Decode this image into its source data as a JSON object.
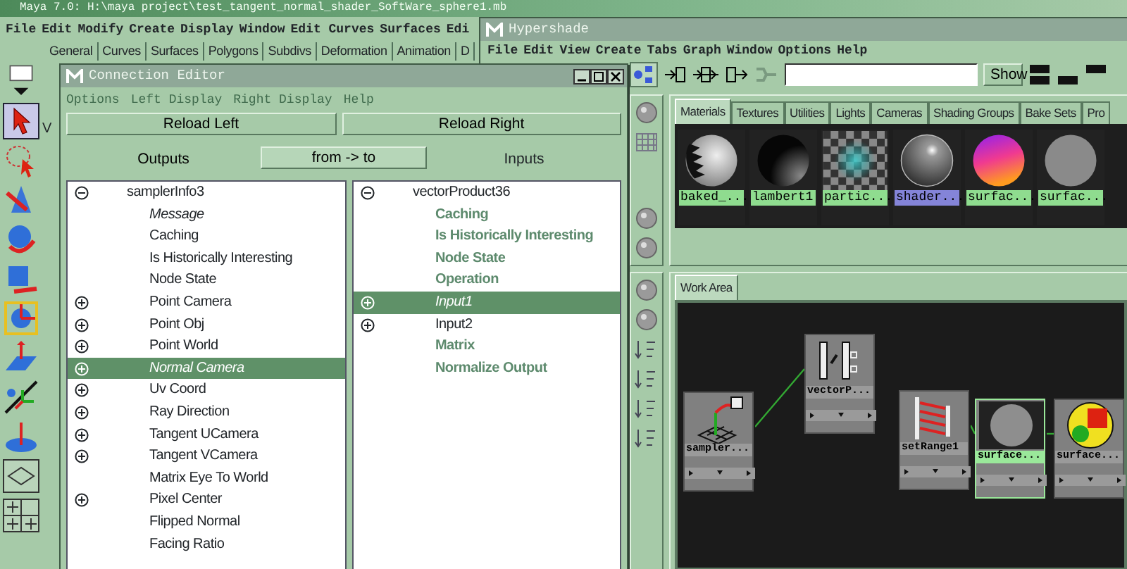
{
  "maya_window": {
    "title": "Maya 7.0: H:\\maya project\\test_tangent_normal_shader_SoftWare_sphere1.mb",
    "menu": [
      "File",
      "Edit",
      "Modify",
      "Create",
      "Display",
      "Window",
      "Edit Curves",
      "Surfaces",
      "Edi"
    ],
    "shelf_tabs": [
      "General",
      "Curves",
      "Surfaces",
      "Polygons",
      "Subdivs",
      "Deformation",
      "Animation",
      "D"
    ],
    "panel_menu": "V"
  },
  "connection_editor": {
    "title": "Connection Editor",
    "menu": [
      {
        "label": "Options",
        "disabled": true
      },
      {
        "label": "Left Display",
        "disabled": true
      },
      {
        "label": "Right Display",
        "disabled": true
      },
      {
        "label": "Help",
        "disabled": true
      }
    ],
    "reload_buttons": [
      "Reload Left",
      "Reload Right"
    ],
    "outputs_label": "Outputs",
    "mode_button": "from -> to",
    "inputs_label": "Inputs",
    "left_list": {
      "node": {
        "label": "samplerInfo3",
        "expanded": true
      },
      "attributes": [
        {
          "label": "Message",
          "expandable": false,
          "connected": true,
          "readonly": false,
          "selected": false
        },
        {
          "label": "Caching",
          "expandable": false,
          "connected": false,
          "readonly": false,
          "selected": false
        },
        {
          "label": "Is Historically Interesting",
          "expandable": false,
          "connected": false,
          "readonly": false,
          "selected": false
        },
        {
          "label": "Node State",
          "expandable": false,
          "connected": false,
          "readonly": false,
          "selected": false
        },
        {
          "label": "Point Camera",
          "expandable": true,
          "connected": false,
          "readonly": false,
          "selected": false
        },
        {
          "label": "Point Obj",
          "expandable": true,
          "connected": false,
          "readonly": false,
          "selected": false
        },
        {
          "label": "Point World",
          "expandable": true,
          "connected": false,
          "readonly": false,
          "selected": false
        },
        {
          "label": "Normal Camera",
          "expandable": true,
          "connected": true,
          "readonly": false,
          "selected": true
        },
        {
          "label": "Uv Coord",
          "expandable": true,
          "connected": false,
          "readonly": false,
          "selected": false
        },
        {
          "label": "Ray Direction",
          "expandable": true,
          "connected": false,
          "readonly": false,
          "selected": false
        },
        {
          "label": "Tangent UCamera",
          "expandable": true,
          "connected": false,
          "readonly": false,
          "selected": false
        },
        {
          "label": "Tangent VCamera",
          "expandable": true,
          "connected": false,
          "readonly": false,
          "selected": false
        },
        {
          "label": "Matrix Eye To World",
          "expandable": false,
          "connected": false,
          "readonly": false,
          "selected": false
        },
        {
          "label": "Pixel Center",
          "expandable": true,
          "connected": false,
          "readonly": false,
          "selected": false
        },
        {
          "label": "Flipped Normal",
          "expandable": false,
          "connected": false,
          "readonly": false,
          "selected": false
        },
        {
          "label": "Facing Ratio",
          "expandable": false,
          "connected": false,
          "readonly": false,
          "selected": false
        }
      ]
    },
    "right_list": {
      "node": {
        "label": "vectorProduct36",
        "expanded": true
      },
      "attributes": [
        {
          "label": "Caching",
          "expandable": false,
          "connected": false,
          "readonly": true,
          "selected": false
        },
        {
          "label": "Is Historically Interesting",
          "expandable": false,
          "connected": false,
          "readonly": true,
          "selected": false
        },
        {
          "label": "Node State",
          "expandable": false,
          "connected": false,
          "readonly": true,
          "selected": false
        },
        {
          "label": "Operation",
          "expandable": false,
          "connected": false,
          "readonly": true,
          "selected": false
        },
        {
          "label": "Input1",
          "expandable": true,
          "connected": true,
          "readonly": false,
          "selected": true
        },
        {
          "label": "Input2",
          "expandable": true,
          "connected": false,
          "readonly": false,
          "selected": false
        },
        {
          "label": "Matrix",
          "expandable": false,
          "connected": false,
          "readonly": true,
          "selected": false
        },
        {
          "label": "Normalize Output",
          "expandable": false,
          "connected": false,
          "readonly": true,
          "selected": false
        }
      ]
    }
  },
  "hypershade": {
    "title": "Hypershade",
    "menu": [
      "File",
      "Edit",
      "View",
      "Create",
      "Tabs",
      "Graph",
      "Window",
      "Options",
      "Help"
    ],
    "show_button": "Show",
    "tabs": [
      {
        "label": "Materials",
        "selected": true
      },
      {
        "label": "Textures",
        "selected": false
      },
      {
        "label": "Utilities",
        "selected": false
      },
      {
        "label": "Lights",
        "selected": false
      },
      {
        "label": "Cameras",
        "selected": false
      },
      {
        "label": "Shading Groups",
        "selected": false
      },
      {
        "label": "Bake Sets",
        "selected": false
      },
      {
        "label": "Pro",
        "selected": false
      }
    ],
    "swatches": [
      {
        "label": "baked_...",
        "kind": "baked",
        "selected": false
      },
      {
        "label": "lambert1",
        "kind": "lambert",
        "selected": false
      },
      {
        "label": "partic...",
        "kind": "particle",
        "selected": false
      },
      {
        "label": "shader...",
        "kind": "shader",
        "selected": true
      },
      {
        "label": "surfac...",
        "kind": "surface",
        "selected": false
      },
      {
        "label": "surfac...",
        "kind": "grey",
        "selected": false
      }
    ],
    "work_area_tab": "Work Area",
    "nodes": [
      {
        "label": "sampler...",
        "kind": "sampler",
        "selected": false
      },
      {
        "label": "vectorP...",
        "kind": "vector",
        "selected": false
      },
      {
        "label": "setRange1",
        "kind": "range",
        "selected": false
      },
      {
        "label": "surface...",
        "kind": "grey",
        "selected": true
      },
      {
        "label": "surface...",
        "kind": "shaded",
        "selected": false
      }
    ]
  }
}
